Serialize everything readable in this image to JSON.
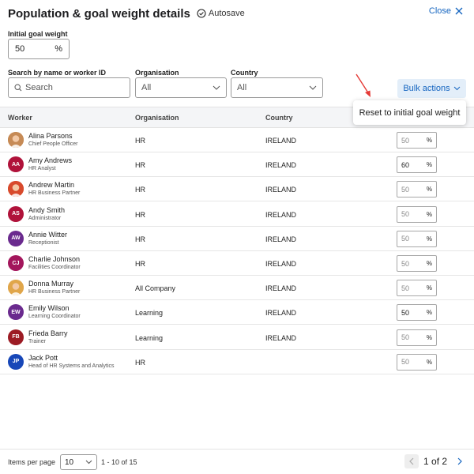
{
  "header": {
    "title": "Population & goal weight details",
    "autosave_label": "Autosave",
    "close_label": "Close"
  },
  "initial_goal_weight": {
    "label": "Initial goal weight",
    "value": "50",
    "unit": "%"
  },
  "filters": {
    "search_label": "Search by name or worker ID",
    "search_placeholder": "Search",
    "organisation_label": "Organisation",
    "organisation_value": "All",
    "country_label": "Country",
    "country_value": "All"
  },
  "bulk_actions": {
    "label": "Bulk actions",
    "menu_items": [
      "Reset to initial goal weight"
    ]
  },
  "table": {
    "columns": [
      "Worker",
      "Organisation",
      "Country"
    ],
    "rows": [
      {
        "name": "Alina Parsons",
        "title": "Chief People Officer",
        "organisation": "HR",
        "country": "IRELAND",
        "weight": "50",
        "edited": false,
        "avatar": {
          "type": "photo",
          "color": "#c68a55"
        }
      },
      {
        "name": "Amy Andrews",
        "title": "HR Analyst",
        "organisation": "HR",
        "country": "IRELAND",
        "weight": "60",
        "edited": true,
        "avatar": {
          "type": "initials",
          "initials": "AA",
          "color": "#b0123a"
        }
      },
      {
        "name": "Andrew Martin",
        "title": "HR Business Partner",
        "organisation": "HR",
        "country": "IRELAND",
        "weight": "50",
        "edited": false,
        "avatar": {
          "type": "photo",
          "color": "#d84a2c"
        }
      },
      {
        "name": "Andy Smith",
        "title": "Administrator",
        "organisation": "HR",
        "country": "IRELAND",
        "weight": "50",
        "edited": false,
        "avatar": {
          "type": "initials",
          "initials": "AS",
          "color": "#b0123a"
        }
      },
      {
        "name": "Annie Witter",
        "title": "Receptionist",
        "organisation": "HR",
        "country": "IRELAND",
        "weight": "50",
        "edited": false,
        "avatar": {
          "type": "initials",
          "initials": "AW",
          "color": "#6a2a8e"
        }
      },
      {
        "name": "Charlie Johnson",
        "title": "Facilities Coordinator",
        "organisation": "HR",
        "country": "IRELAND",
        "weight": "50",
        "edited": false,
        "avatar": {
          "type": "initials",
          "initials": "CJ",
          "color": "#a3165c"
        }
      },
      {
        "name": "Donna Murray",
        "title": "HR Business Partner",
        "organisation": "All Company",
        "country": "IRELAND",
        "weight": "50",
        "edited": false,
        "avatar": {
          "type": "photo",
          "color": "#e0a64a"
        }
      },
      {
        "name": "Emily Wilson",
        "title": "Learning Coordinator",
        "organisation": "Learning",
        "country": "IRELAND",
        "weight": "50",
        "edited": true,
        "avatar": {
          "type": "initials",
          "initials": "EW",
          "color": "#6a2a8e"
        }
      },
      {
        "name": "Frieda Barry",
        "title": "Trainer",
        "organisation": "Learning",
        "country": "IRELAND",
        "weight": "50",
        "edited": false,
        "avatar": {
          "type": "initials",
          "initials": "FB",
          "color": "#9c1b24"
        }
      },
      {
        "name": "Jack Pott",
        "title": "Head of HR Systems and Analytics",
        "organisation": "HR",
        "country": "",
        "weight": "50",
        "edited": false,
        "avatar": {
          "type": "initials",
          "initials": "JP",
          "color": "#1747b8"
        }
      }
    ]
  },
  "footer": {
    "items_per_page_label": "Items per page",
    "items_per_page_value": "10",
    "range_text": "1 - 10 of 15",
    "current_page": "1",
    "of_label": "of",
    "total_pages": "2"
  },
  "colors": {
    "accent": "#1565c0",
    "bulk_bg": "#e3eef9",
    "arrow": "#e53935"
  }
}
